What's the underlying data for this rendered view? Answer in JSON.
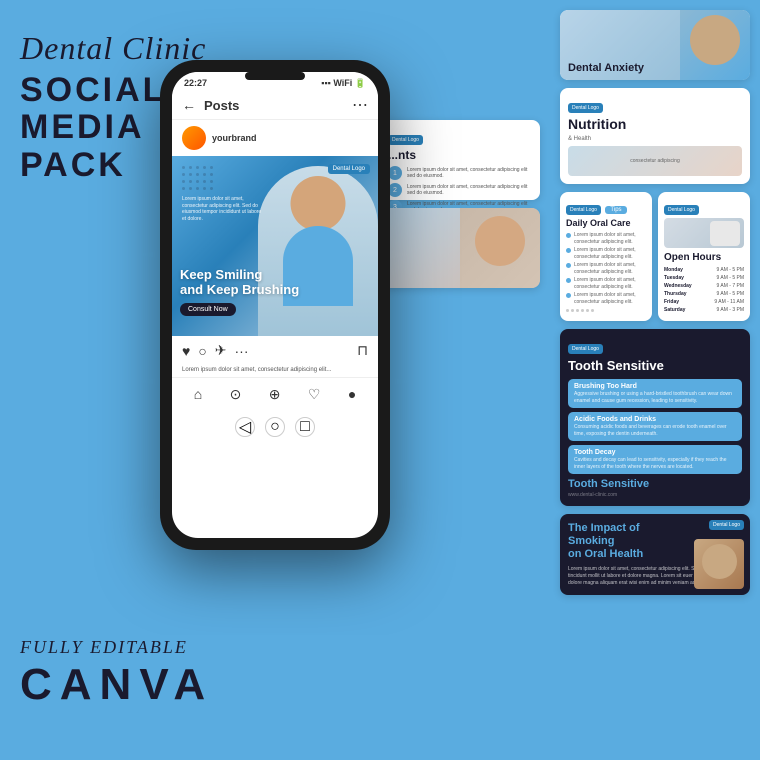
{
  "left": {
    "title_script": "Dental Clinic",
    "title_line1": "SOCIAL",
    "title_line2": "MEDIA PACK",
    "bottom_label": "FULLY EDITABLE",
    "bottom_brand": "CANVA"
  },
  "phone": {
    "time": "22:27",
    "nav_title": "Posts",
    "profile_name": "yourbrand",
    "post_headline_line1": "Keep Smiling",
    "post_headline_line2": "and Keep Brushing",
    "post_button": "Consult Now",
    "logo_badge": "Dental Logo",
    "caption": "Lorem ipsum dolor sit amet, consectetur adipiscing elit..."
  },
  "cards": {
    "dental_anxiety": "Dental Anxiety",
    "nutrition": "Nutrition",
    "daily_oral_care_tips": "Tips",
    "daily_oral_care_title": "Daily Oral Care",
    "daily_oral_items": [
      "Lorem ipsum dolor sit amet, consectetur adipiscing elit.",
      "Lorem ipsum dolor sit amet, consectetur adipiscing elit.",
      "Lorem ipsum dolor sit amet, consectetur adipiscing elit.",
      "Lorem ipsum dolor sit amet, consectetur adipiscing elit.",
      "Lorem ipsum dolor sit amet, consectetur adipiscing elit."
    ],
    "open_hours_title": "Open Hours",
    "hours": [
      {
        "day": "Monday",
        "time": "9 AM - 5 PM"
      },
      {
        "day": "Tuesday",
        "time": "9 AM - 5 PM"
      },
      {
        "day": "Wednesday",
        "time": "9 AM - 7 PM"
      },
      {
        "day": "Thursday",
        "time": "9 AM - 5 PM"
      },
      {
        "day": "Friday",
        "time": "9 AM - 11 AM"
      },
      {
        "day": "Saturday",
        "time": "9 AM - 3 PM"
      }
    ],
    "tooth_sensitive_title": "Tooth Sensitive",
    "tooth_causes": [
      {
        "title": "Brushing Too Hard",
        "text": "Aggressive brushing or using a hard-bristled toothbrush can wear down enamel and cause gum recession, leading to sensitivity."
      },
      {
        "title": "Acidic Foods and Drinks",
        "text": "Consuming acidic foods and beverages can erode tooth enamel over time, exposing the dentin underneath."
      },
      {
        "title": "Tooth Decay",
        "text": "Cavities and decay can lead to sensitivity, especially if they reach the inner layers of the tooth where the nerves are located."
      }
    ],
    "tooth_bottom_label": "Tooth Sensitive",
    "smoking_title_line1": "The Impact of",
    "smoking_title_highlight": "Smoking",
    "smoking_title_line2": "on Oral Health",
    "smoking_text": "Lorem ipsum dolor sit amet, consectetur adipiscing elit. Sed tye euismod tincidunt mollit ut labore et dolore magna. Lorem sit euer mollipar at labore at dolore magna aliquam erat wisi enim ad minim veniam adipiscing.",
    "appointments_title": "nts",
    "appt_items": [
      "Lorem ipsum dolor sit amet, consectetur adipiscing elit sed do eiusmod.",
      "Lorem ipsum dolor sit amet, consectetur adipiscing elit sed do eiusmod.",
      "Lorem ipsum dolor sit amet, consectetur adipiscing elit sed do eiusmod."
    ],
    "dental_logo": "Dental Logo"
  }
}
